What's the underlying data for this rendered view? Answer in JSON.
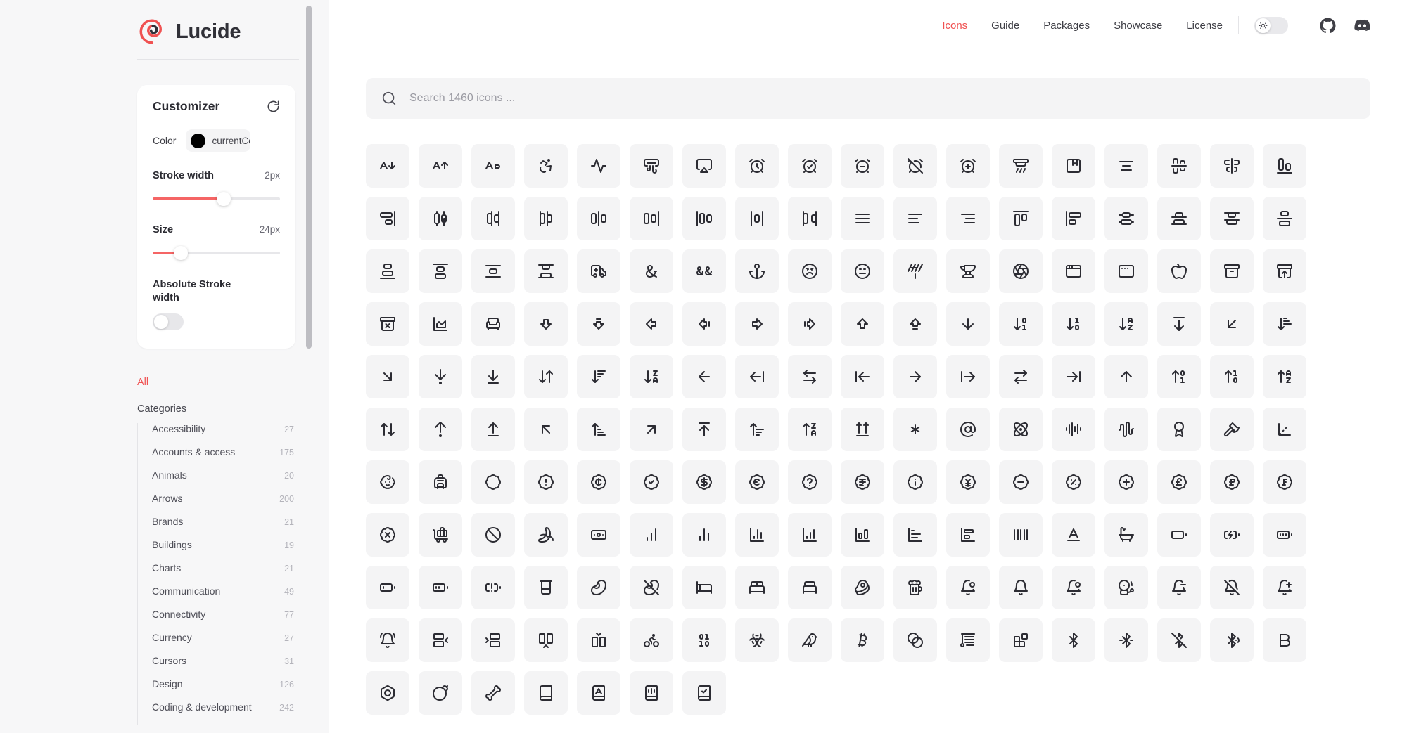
{
  "brand": {
    "name": "Lucide",
    "logo_icon": "lucide-spiral-logo"
  },
  "customizer": {
    "title": "Customizer",
    "reset_icon": "rotate-cw-icon",
    "color_label": "Color",
    "color_value": "currentColor",
    "color_swatch": "#000000",
    "stroke_width_label": "Stroke width",
    "stroke_width_value": "2px",
    "stroke_width_percent": 56,
    "size_label": "Size",
    "size_value": "24px",
    "size_percent": 22,
    "absolute_stroke_label": "Absolute Stroke width",
    "absolute_stroke_on": false,
    "accent_color": "#f56565"
  },
  "sidebar": {
    "all_label": "All",
    "all_color": "#f05252",
    "categories_title": "Categories",
    "categories": [
      {
        "label": "Accessibility",
        "count": "27"
      },
      {
        "label": "Accounts & access",
        "count": "175"
      },
      {
        "label": "Animals",
        "count": "20"
      },
      {
        "label": "Arrows",
        "count": "200"
      },
      {
        "label": "Brands",
        "count": "21"
      },
      {
        "label": "Buildings",
        "count": "19"
      },
      {
        "label": "Charts",
        "count": "21"
      },
      {
        "label": "Communication",
        "count": "49"
      },
      {
        "label": "Connectivity",
        "count": "77"
      },
      {
        "label": "Currency",
        "count": "27"
      },
      {
        "label": "Cursors",
        "count": "31"
      },
      {
        "label": "Design",
        "count": "126"
      },
      {
        "label": "Coding & development",
        "count": "242"
      }
    ]
  },
  "topnav": {
    "items": [
      {
        "label": "Icons",
        "active": true
      },
      {
        "label": "Guide",
        "active": false
      },
      {
        "label": "Packages",
        "active": false
      },
      {
        "label": "Showcase",
        "active": false
      },
      {
        "label": "License",
        "active": false
      }
    ],
    "active_color": "#f05252",
    "theme_toggle_icon": "sun-icon",
    "theme_mode": "light",
    "socials": [
      {
        "name": "github-icon"
      },
      {
        "name": "discord-icon"
      }
    ]
  },
  "search": {
    "placeholder": "Search 1460 icons ...",
    "value": "",
    "icon": "search-icon",
    "icon_count": 1460
  },
  "grid": {
    "columns": 18,
    "icons": [
      "a-arrow-down",
      "a-arrow-up",
      "a-large-small",
      "accessibility",
      "activity",
      "air-vent",
      "airplay",
      "alarm-clock",
      "alarm-clock-check",
      "alarm-clock-minus",
      "alarm-clock-off",
      "alarm-clock-plus",
      "alarm-smoke",
      "album",
      "align-center",
      "align-center-horizontal",
      "align-center-vertical",
      "align-end-horizontal",
      "align-end-vertical",
      "align-horizontal-distribute-center",
      "align-horizontal-distribute-end",
      "align-horizontal-distribute-start",
      "align-horizontal-justify-center",
      "align-horizontal-justify-end",
      "align-horizontal-justify-start",
      "align-horizontal-space-around",
      "align-horizontal-space-between",
      "align-justify",
      "align-left",
      "align-right",
      "align-start-horizontal",
      "align-start-vertical",
      "align-vertical-distribute-center",
      "align-vertical-distribute-end",
      "align-vertical-distribute-start",
      "align-vertical-justify-center",
      "align-vertical-justify-end",
      "align-vertical-justify-start",
      "align-vertical-space-around",
      "align-vertical-space-between",
      "ambulance",
      "ampersand",
      "ampersands",
      "anchor",
      "angry",
      "annoyed",
      "antenna",
      "anvil",
      "aperture",
      "app-window",
      "app-window-mac",
      "apple",
      "archive",
      "archive-restore",
      "archive-x",
      "area-chart",
      "armchair",
      "arrow-big-down",
      "arrow-big-down-dash",
      "arrow-big-left",
      "arrow-big-left-dash",
      "arrow-big-right",
      "arrow-big-right-dash",
      "arrow-big-up",
      "arrow-big-up-dash",
      "arrow-down",
      "arrow-down-0-1",
      "arrow-down-1-0",
      "arrow-down-a-z",
      "arrow-down-from-line",
      "arrow-down-left",
      "arrow-down-narrow-wide",
      "arrow-down-right",
      "arrow-down-to-dot",
      "arrow-down-to-line",
      "arrow-down-up",
      "arrow-down-wide-narrow",
      "arrow-down-z-a",
      "arrow-left",
      "arrow-left-from-line",
      "arrow-left-right",
      "arrow-left-to-line",
      "arrow-right",
      "arrow-right-from-line",
      "arrow-right-left",
      "arrow-right-to-line",
      "arrow-up",
      "arrow-up-0-1",
      "arrow-up-1-0",
      "arrow-up-a-z",
      "arrow-up-down",
      "arrow-up-from-dot",
      "arrow-up-from-line",
      "arrow-up-left",
      "arrow-up-narrow-wide",
      "arrow-up-right",
      "arrow-up-to-line",
      "arrow-up-wide-narrow",
      "arrow-up-z-a",
      "arrows-up-from-line",
      "asterisk",
      "at-sign",
      "atom",
      "audio-lines",
      "audio-waveform",
      "award",
      "axe",
      "axis-3d",
      "baby",
      "backpack",
      "badge",
      "badge-alert",
      "badge-cent",
      "badge-check",
      "badge-dollar-sign",
      "badge-euro",
      "badge-help",
      "badge-indian-rupee",
      "badge-info",
      "badge-japanese-yen",
      "badge-minus",
      "badge-percent",
      "badge-plus",
      "badge-pound-sterling",
      "badge-russian-ruble",
      "badge-swiss-franc",
      "badge-x",
      "baggage-claim",
      "ban",
      "banana",
      "banknote",
      "bar-chart",
      "bar-chart-2",
      "bar-chart-3",
      "bar-chart-4",
      "bar-chart-big",
      "bar-chart-horizontal",
      "bar-chart-horizontal-big",
      "barcode",
      "baseline",
      "bath",
      "battery",
      "battery-charging",
      "battery-full",
      "battery-low",
      "battery-medium",
      "battery-warning",
      "beaker",
      "bean",
      "bean-off",
      "bed",
      "bed-double",
      "bed-single",
      "beef",
      "beer",
      "bell-dot",
      "bell",
      "bell-dot-2",
      "bell-electric",
      "bell-minus",
      "bell-off",
      "bell-plus",
      "bell-ring",
      "between-horizontal-end",
      "between-horizontal-start",
      "between-vertical-end",
      "between-vertical-start",
      "bike",
      "binary",
      "biohazard",
      "bird",
      "bitcoin",
      "blend",
      "blinds",
      "blocks",
      "bluetooth",
      "bluetooth-connected",
      "bluetooth-off",
      "bluetooth-searching",
      "bold",
      "bolt",
      "bomb",
      "bone",
      "book",
      "book-a",
      "book-audio",
      "book-check"
    ]
  }
}
